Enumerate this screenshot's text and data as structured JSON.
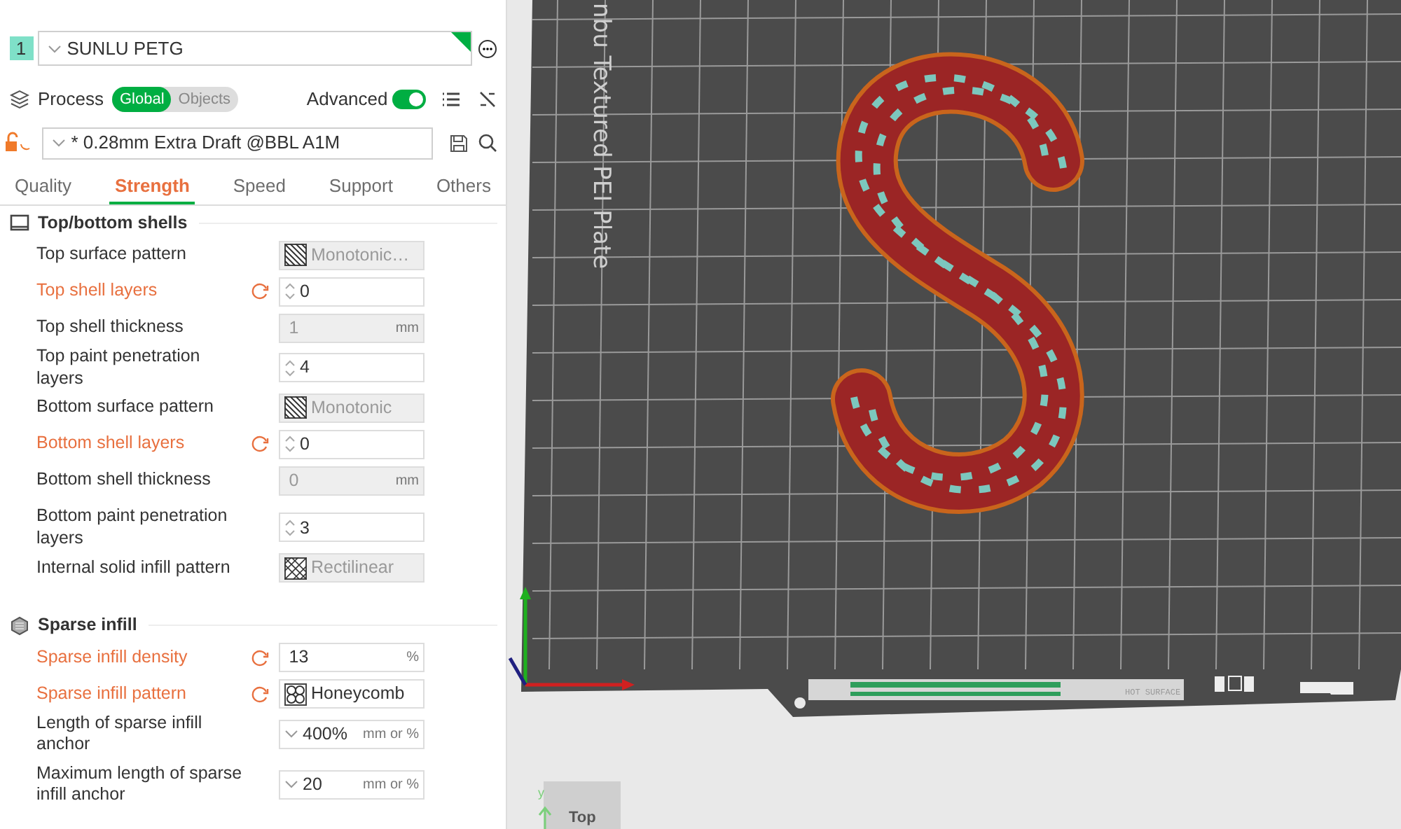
{
  "filament": {
    "index": "1",
    "name": "SUNLU PETG"
  },
  "process": {
    "title": "Process",
    "scopes": [
      {
        "label": "Global",
        "selected": true
      },
      {
        "label": "Objects",
        "selected": false
      }
    ],
    "advanced_label": "Advanced",
    "advanced_on": true,
    "preset": "* 0.28mm Extra Draft @BBL A1M"
  },
  "tabs": [
    {
      "label": "Quality",
      "selected": false
    },
    {
      "label": "Strength",
      "selected": true
    },
    {
      "label": "Speed",
      "selected": false
    },
    {
      "label": "Support",
      "selected": false
    },
    {
      "label": "Others",
      "selected": false
    }
  ],
  "sections": [
    {
      "title": "Top/bottom shells",
      "kind": "shells",
      "rows": [
        {
          "label": "Top surface pattern",
          "modified": false,
          "kind": "hatch-combo",
          "value": "Monotonic…",
          "disabled": true
        },
        {
          "label": "Top shell layers",
          "modified": true,
          "kind": "spin",
          "value": "0",
          "disabled": false
        },
        {
          "label": "Top shell thickness",
          "modified": false,
          "kind": "unit",
          "value": "1",
          "unit": "mm",
          "disabled": true
        },
        {
          "label": "Top paint penetration layers",
          "modified": false,
          "kind": "spin",
          "value": "4",
          "disabled": false
        },
        {
          "label": "Bottom surface pattern",
          "modified": false,
          "kind": "hatch-combo",
          "value": "Monotonic",
          "disabled": true
        },
        {
          "label": "Bottom shell layers",
          "modified": true,
          "kind": "spin",
          "value": "0",
          "disabled": false
        },
        {
          "label": "Bottom shell thickness",
          "modified": false,
          "kind": "unit",
          "value": "0",
          "unit": "mm",
          "disabled": true
        },
        {
          "label": "Bottom paint penetration layers",
          "modified": false,
          "kind": "spin",
          "value": "3",
          "disabled": false
        },
        {
          "label": "Internal solid infill pattern",
          "modified": false,
          "kind": "crosshatch-combo",
          "value": "Rectilinear",
          "disabled": true
        }
      ]
    },
    {
      "title": "Sparse infill",
      "kind": "infill",
      "rows": [
        {
          "label": "Sparse infill density",
          "modified": true,
          "kind": "unit",
          "value": "13",
          "unit": "%",
          "disabled": false
        },
        {
          "label": "Sparse infill pattern",
          "modified": true,
          "kind": "cell-combo",
          "value": "Honeycomb",
          "disabled": false
        },
        {
          "label": "Length of sparse infill anchor",
          "modified": false,
          "kind": "dropdown",
          "value": "400%",
          "unit": "mm or %",
          "disabled": false
        },
        {
          "label": "Maximum length of sparse infill anchor",
          "modified": false,
          "kind": "dropdown",
          "value": "20",
          "unit": "mm or %",
          "disabled": false
        }
      ]
    }
  ],
  "viewport": {
    "plate_label": "nbu Textured PEI Plate",
    "plate_warning": "HOT SURFACE",
    "view_cube": "Top",
    "axis_label": "y"
  }
}
